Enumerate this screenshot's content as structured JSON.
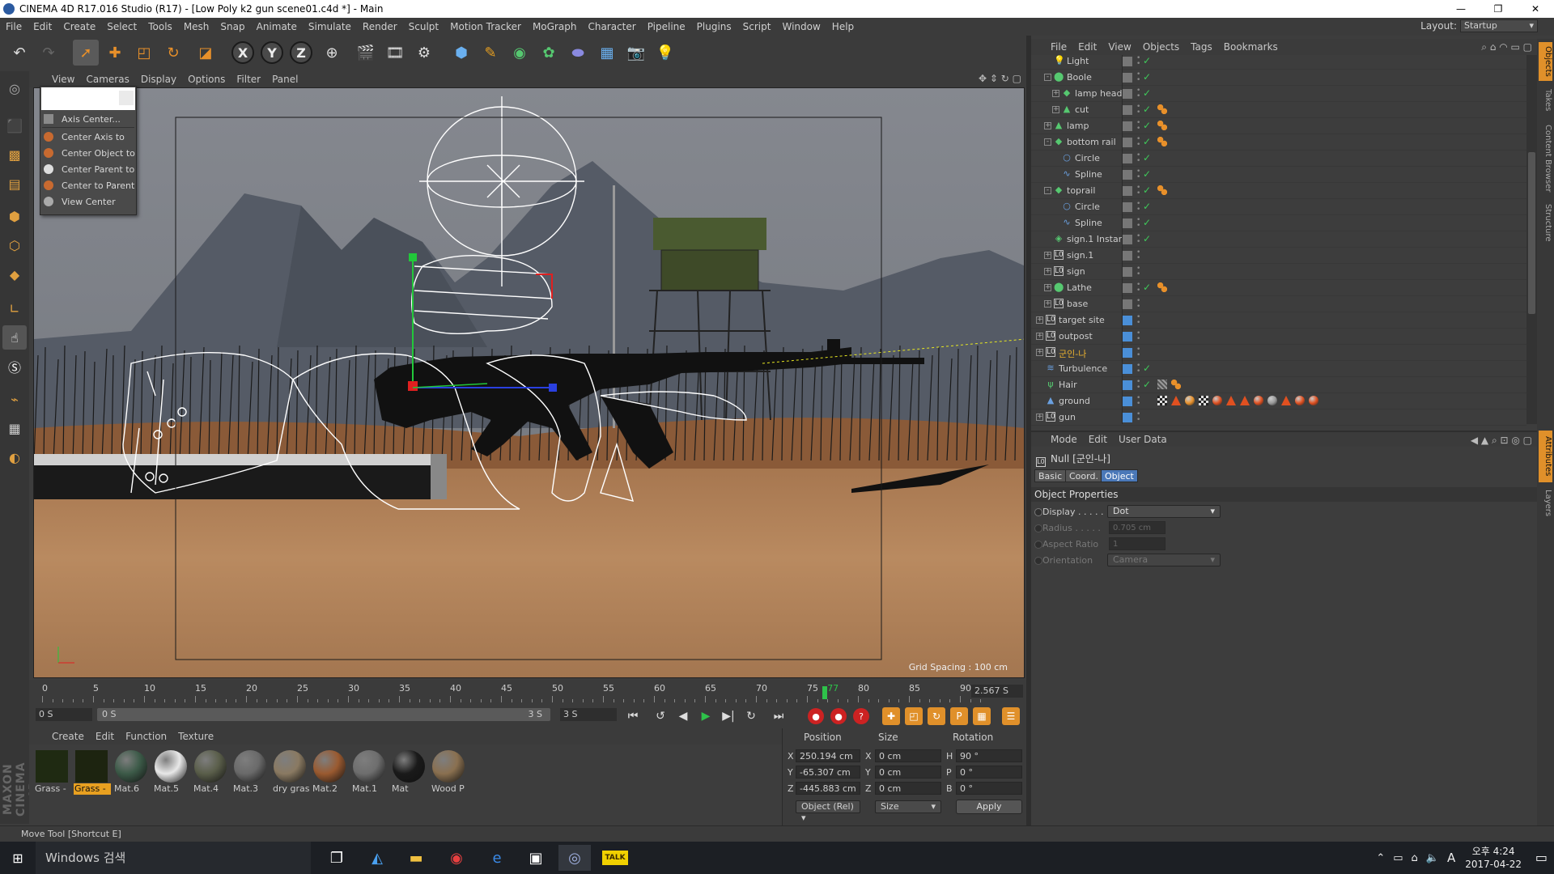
{
  "window": {
    "title": "CINEMA 4D R17.016 Studio (R17) - [Low Poly k2 gun scene01.c4d *] - Main",
    "controls": [
      "—",
      "❐",
      "✕"
    ]
  },
  "menubar": {
    "items": [
      "File",
      "Edit",
      "Create",
      "Select",
      "Tools",
      "Mesh",
      "Snap",
      "Animate",
      "Simulate",
      "Render",
      "Sculpt",
      "Motion Tracker",
      "MoGraph",
      "Character",
      "Pipeline",
      "Plugins",
      "Script",
      "Window",
      "Help"
    ],
    "layout_label": "Layout:",
    "layout_value": "Startup"
  },
  "toolbar": {
    "axis_x": "X",
    "axis_y": "Y",
    "axis_z": "Z"
  },
  "viewport": {
    "menu": [
      "View",
      "Cameras",
      "Display",
      "Options",
      "Filter",
      "Panel"
    ],
    "grid_spacing": "Grid Spacing : 100 cm"
  },
  "axis_menu": {
    "items": [
      "Axis Center...",
      "Center Axis to",
      "Center Object to",
      "Center Parent to",
      "Center to Parent",
      "View Center"
    ]
  },
  "timeline": {
    "ticks": [
      "0",
      "5",
      "10",
      "15",
      "20",
      "25",
      "30",
      "35",
      "40",
      "45",
      "50",
      "55",
      "60",
      "65",
      "70",
      "75",
      "77",
      "80",
      "85",
      "90"
    ],
    "current_frame": 77,
    "time_field": "2.567 S"
  },
  "transport": {
    "start_field": "0 S",
    "slider_start": "0 S",
    "slider_end": "3 S",
    "end_field": "3 S"
  },
  "material_manager": {
    "menu": [
      "Create",
      "Edit",
      "Function",
      "Texture"
    ],
    "materials": [
      {
        "name": "Grass -",
        "color": "#1f2a12",
        "selected": false
      },
      {
        "name": "Grass -",
        "color": "#1d2410",
        "selected": true
      },
      {
        "name": "Mat.6",
        "color": "#3c5a48",
        "selected": false
      },
      {
        "name": "Mat.5",
        "color": "#e8e8e8",
        "selected": false
      },
      {
        "name": "Mat.4",
        "color": "#5a5e4a",
        "selected": false
      },
      {
        "name": "Mat.3",
        "color": "#6a6a6a",
        "selected": false
      },
      {
        "name": "dry gras",
        "color": "#8a7a62",
        "selected": false
      },
      {
        "name": "Mat.2",
        "color": "#9a5a30",
        "selected": false
      },
      {
        "name": "Mat.1",
        "color": "#6e6e6e",
        "selected": false
      },
      {
        "name": "Mat",
        "color": "#1a1a1a",
        "selected": false
      },
      {
        "name": "Wood P",
        "color": "#8a7050",
        "selected": false
      }
    ]
  },
  "coord_manager": {
    "headers": [
      "Position",
      "Size",
      "Rotation"
    ],
    "rows": [
      {
        "axis": "X",
        "pos": "250.194 cm",
        "size_axis": "X",
        "size": "0 cm",
        "rot_axis": "H",
        "rot": "90 °"
      },
      {
        "axis": "Y",
        "pos": "-65.307 cm",
        "size_axis": "Y",
        "size": "0 cm",
        "rot_axis": "P",
        "rot": "0 °"
      },
      {
        "axis": "Z",
        "pos": "-445.883 cm",
        "size_axis": "Z",
        "size": "0 cm",
        "rot_axis": "B",
        "rot": "0 °"
      }
    ],
    "mode_select": "Object (Rel)",
    "size_select": "Size",
    "apply": "Apply"
  },
  "status": "Move Tool [Shortcut E]",
  "object_manager": {
    "menu": [
      "File",
      "Edit",
      "View",
      "Objects",
      "Tags",
      "Bookmarks"
    ],
    "rows": [
      {
        "name": "Light",
        "depth": 1,
        "icon": "💡",
        "icon_color": "#dddddd",
        "expand": "",
        "vis": "gray",
        "check": true,
        "tags": 0
      },
      {
        "name": "Boole",
        "depth": 1,
        "icon": "⬤",
        "icon_color": "#56c870",
        "expand": "-",
        "vis": "gray",
        "check": true,
        "tags": 0
      },
      {
        "name": "lamp head",
        "depth": 2,
        "icon": "◆",
        "icon_color": "#56c870",
        "expand": "+",
        "vis": "gray",
        "check": true,
        "tags": 0
      },
      {
        "name": "cut",
        "depth": 2,
        "icon": "▲",
        "icon_color": "#56c870",
        "expand": "+",
        "vis": "gray",
        "check": true,
        "tags": 1
      },
      {
        "name": "lamp",
        "depth": 1,
        "icon": "▲",
        "icon_color": "#56c870",
        "expand": "+",
        "vis": "gray",
        "check": true,
        "tags": 1
      },
      {
        "name": "bottom  rail",
        "depth": 1,
        "icon": "◆",
        "icon_color": "#56c870",
        "expand": "-",
        "vis": "gray",
        "check": true,
        "tags": 1
      },
      {
        "name": "Circle",
        "depth": 2,
        "icon": "○",
        "icon_color": "#6aa0e0",
        "expand": "",
        "vis": "gray",
        "check": true,
        "tags": 0
      },
      {
        "name": "Spline",
        "depth": 2,
        "icon": "∿",
        "icon_color": "#6aa0e0",
        "expand": "",
        "vis": "gray",
        "check": true,
        "tags": 0
      },
      {
        "name": "toprail",
        "depth": 1,
        "icon": "◆",
        "icon_color": "#56c870",
        "expand": "-",
        "vis": "gray",
        "check": true,
        "tags": 1
      },
      {
        "name": "Circle",
        "depth": 2,
        "icon": "○",
        "icon_color": "#6aa0e0",
        "expand": "",
        "vis": "gray",
        "check": true,
        "tags": 0
      },
      {
        "name": "Spline",
        "depth": 2,
        "icon": "∿",
        "icon_color": "#6aa0e0",
        "expand": "",
        "vis": "gray",
        "check": true,
        "tags": 0
      },
      {
        "name": "sign.1 Instan",
        "depth": 1,
        "icon": "◈",
        "icon_color": "#56c870",
        "expand": "",
        "vis": "gray",
        "check": true,
        "tags": 0
      },
      {
        "name": "sign.1",
        "depth": 1,
        "icon": "L0",
        "icon_color": "#dddddd",
        "expand": "+",
        "vis": "gray",
        "check": false,
        "tags": 0
      },
      {
        "name": "sign",
        "depth": 1,
        "icon": "L0",
        "icon_color": "#dddddd",
        "expand": "+",
        "vis": "gray",
        "check": false,
        "tags": 0
      },
      {
        "name": "Lathe",
        "depth": 1,
        "icon": "⬤",
        "icon_color": "#56c870",
        "expand": "+",
        "vis": "gray",
        "check": true,
        "tags": 1
      },
      {
        "name": "base",
        "depth": 1,
        "icon": "L0",
        "icon_color": "#dddddd",
        "expand": "+",
        "vis": "gray",
        "check": false,
        "tags": 0
      },
      {
        "name": "target site",
        "depth": 0,
        "icon": "L0",
        "icon_color": "#dddddd",
        "expand": "+",
        "vis": "blue",
        "check": false,
        "tags": 0
      },
      {
        "name": "outpost",
        "depth": 0,
        "icon": "L0",
        "icon_color": "#dddddd",
        "expand": "+",
        "vis": "blue",
        "check": false,
        "tags": 0
      },
      {
        "name": "군인-나",
        "depth": 0,
        "icon": "L0",
        "icon_color": "#dddddd",
        "expand": "+",
        "vis": "blue",
        "check": false,
        "tags": 0,
        "highlight": true
      },
      {
        "name": "Turbulence",
        "depth": 0,
        "icon": "≋",
        "icon_color": "#6aa0e0",
        "expand": "",
        "vis": "blue",
        "check": true,
        "tags": 0
      },
      {
        "name": "Hair",
        "depth": 0,
        "icon": "ψ",
        "icon_color": "#56c870",
        "expand": "",
        "vis": "blue",
        "check": true,
        "tags": 2
      },
      {
        "name": "ground",
        "depth": 0,
        "icon": "▲",
        "icon_color": "#6aa0e0",
        "expand": "",
        "vis": "blue",
        "check": false,
        "tags": 12
      },
      {
        "name": "gun",
        "depth": 0,
        "icon": "L0",
        "icon_color": "#dddddd",
        "expand": "+",
        "vis": "blue",
        "check": false,
        "tags": 0
      }
    ]
  },
  "attribute_manager": {
    "menu": [
      "Mode",
      "Edit",
      "User Data"
    ],
    "title": "Null [군인-나]",
    "tabs": [
      "Basic",
      "Coord.",
      "Object"
    ],
    "active_tab": "Object",
    "section": "Object Properties",
    "props": [
      {
        "label": "Display . . . . .",
        "value": "Dot",
        "type": "select",
        "dim": false
      },
      {
        "label": "Radius . . . . .",
        "value": "0.705 cm",
        "type": "field",
        "dim": true
      },
      {
        "label": "Aspect Ratio",
        "value": "1",
        "type": "field",
        "dim": true
      },
      {
        "label": "Orientation",
        "value": "Camera",
        "type": "select",
        "dim": true
      }
    ]
  },
  "right_tabs": [
    "Objects",
    "Takes",
    "Content Browser",
    "Structure",
    "Attributes",
    "Layers"
  ],
  "taskbar": {
    "search": "Windows 검색",
    "clock_time": "오후 4:24",
    "clock_date": "2017-04-22",
    "ime": "A"
  }
}
